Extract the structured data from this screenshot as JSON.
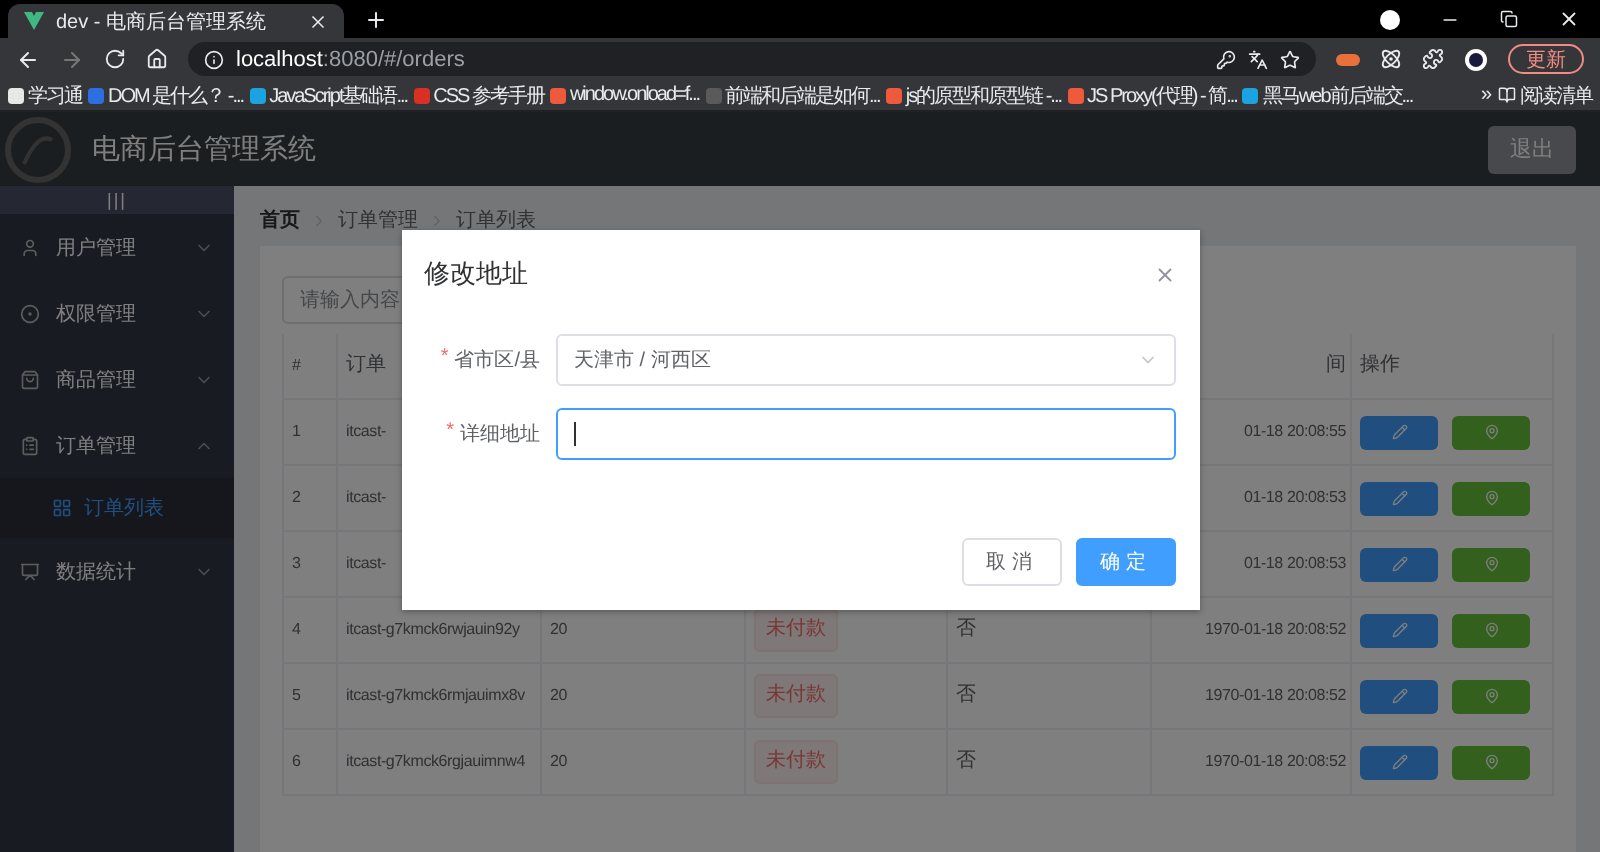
{
  "browser": {
    "tab_title": "dev - 电商后台管理系统",
    "url_host": "localhost",
    "url_rest": ":8080/#/orders",
    "update_button": "更新",
    "bookmarks": [
      {
        "label": "学习通",
        "color": "#e8e8e8"
      },
      {
        "label": "DOM 是什么？ -...",
        "color": "#2b6fe0"
      },
      {
        "label": "JavaScript基础语...",
        "color": "#1aa3e0"
      },
      {
        "label": "CSS 参考手册",
        "color": "#d93025"
      },
      {
        "label": "window.onload=f...",
        "color": "#f05a3c"
      },
      {
        "label": "前端和后端是如何...",
        "color": "#5a5a5a"
      },
      {
        "label": "js的原型和原型链 -...",
        "color": "#f05a3c"
      },
      {
        "label": "JS Proxy(代理) - 简...",
        "color": "#f05a3c"
      },
      {
        "label": "黑马web前后端交...",
        "color": "#1aa3e0"
      }
    ],
    "bookmarks_more": "»",
    "reading_list": "阅读清单"
  },
  "header": {
    "title": "电商后台管理系统",
    "logout": "退出"
  },
  "sidebar": {
    "toggle": "|||",
    "items": [
      {
        "label": "用户管理",
        "expanded": false
      },
      {
        "label": "权限管理",
        "expanded": false
      },
      {
        "label": "商品管理",
        "expanded": false
      },
      {
        "label": "订单管理",
        "expanded": true,
        "children": [
          {
            "label": "订单列表",
            "selected": true
          }
        ]
      },
      {
        "label": "数据统计",
        "expanded": false
      }
    ]
  },
  "breadcrumb": [
    "首页",
    "订单管理",
    "订单列表"
  ],
  "search": {
    "placeholder": "请输入内容"
  },
  "table": {
    "headers": {
      "index": "#",
      "order_number": "订单",
      "time": "间",
      "actions": "操作"
    },
    "rows": [
      {
        "index": "1",
        "order_number": "itcast-",
        "time": "01-18 20:08:55"
      },
      {
        "index": "2",
        "order_number": "itcast-",
        "time": "01-18 20:08:53"
      },
      {
        "index": "3",
        "order_number": "itcast-",
        "time": "01-18 20:08:53"
      },
      {
        "index": "4",
        "order_number": "itcast-g7kmck6rwjauin92y",
        "price": "20",
        "paid": "未付款",
        "shipped": "否",
        "time": "1970-01-18 20:08:52"
      },
      {
        "index": "5",
        "order_number": "itcast-g7kmck6rmjauimx8v",
        "price": "20",
        "paid": "未付款",
        "shipped": "否",
        "time": "1970-01-18 20:08:52"
      },
      {
        "index": "6",
        "order_number": "itcast-g7kmck6rgjauimnw4",
        "price": "20",
        "paid": "未付款",
        "shipped": "否",
        "time": "1970-01-18 20:08:52"
      }
    ]
  },
  "dialog": {
    "title": "修改地址",
    "fields": [
      {
        "kind": "cascader",
        "required_mark": "*",
        "label": "省市区/县",
        "value": "天津市 / 河西区",
        "focused": false
      },
      {
        "kind": "text",
        "required_mark": "*",
        "label": "详细地址",
        "focused": true
      }
    ],
    "buttons": [
      {
        "label": "取消",
        "kind": "default"
      },
      {
        "label": "确定",
        "kind": "primary"
      }
    ]
  }
}
